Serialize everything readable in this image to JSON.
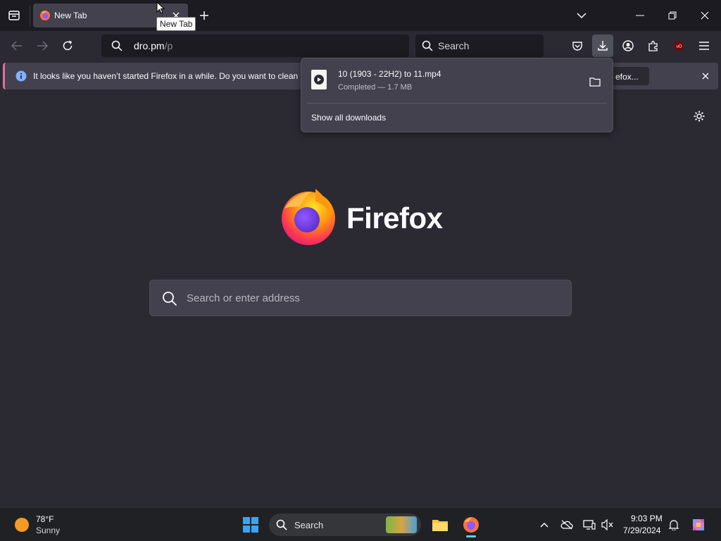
{
  "tabs": [
    {
      "title": "New Tab",
      "close_icon": "close-icon"
    }
  ],
  "tooltip": "New Tab",
  "urlbar": {
    "domain": "dro.pm",
    "path": "/p"
  },
  "searchbar": {
    "placeholder": "Search"
  },
  "notification": {
    "message": "It looks like you haven’t started Firefox in a while. Do you want to clean it",
    "button_label": "efox..."
  },
  "downloads_panel": {
    "filename": "10 (1903 - 22H2) to 11.mp4",
    "status": "Completed — 1.7 MB",
    "show_all": "Show all downloads"
  },
  "content": {
    "brand": "Firefox",
    "search_placeholder": "Search or enter address"
  },
  "taskbar": {
    "weather_temp": "78°F",
    "weather_cond": "Sunny",
    "search_label": "Search",
    "time": "9:03 PM",
    "date": "7/29/2024"
  },
  "colors": {
    "chrome_dark": "#1c1b22",
    "content_bg": "#2b2a33",
    "panel": "#42414d",
    "accent_pink": "#e66ca0",
    "info_blue": "#80ebff"
  }
}
